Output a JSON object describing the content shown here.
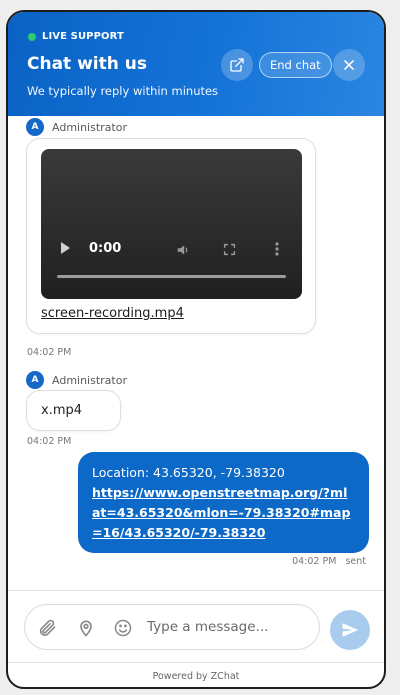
{
  "header": {
    "live_label": "LIVE SUPPORT",
    "title": "Chat with us",
    "subtitle": "We typically reply within minutes",
    "end_chat_label": "End chat",
    "live_dot_color": "#2ecc71",
    "brand_color": "#0d69c8"
  },
  "messages": [
    {
      "sender": "Administrator",
      "avatar_initial": "A",
      "video": {
        "time": "0:00"
      },
      "file_name": "screen-recording.mp4",
      "time": "04:02 PM"
    },
    {
      "sender": "Administrator",
      "avatar_initial": "A",
      "text": "x.mp4",
      "time": "04:02 PM"
    },
    {
      "location_text": "Location: 43.65320, -79.38320",
      "link": "https://www.openstreetmap.org/?mlat=43.65320&mlon=-79.38320#map=16/43.65320/-79.38320",
      "time": "04:02 PM",
      "status": "sent"
    }
  ],
  "composer": {
    "placeholder": "Type a message..."
  },
  "footer": {
    "powered_by": "Powered by ZChat"
  }
}
